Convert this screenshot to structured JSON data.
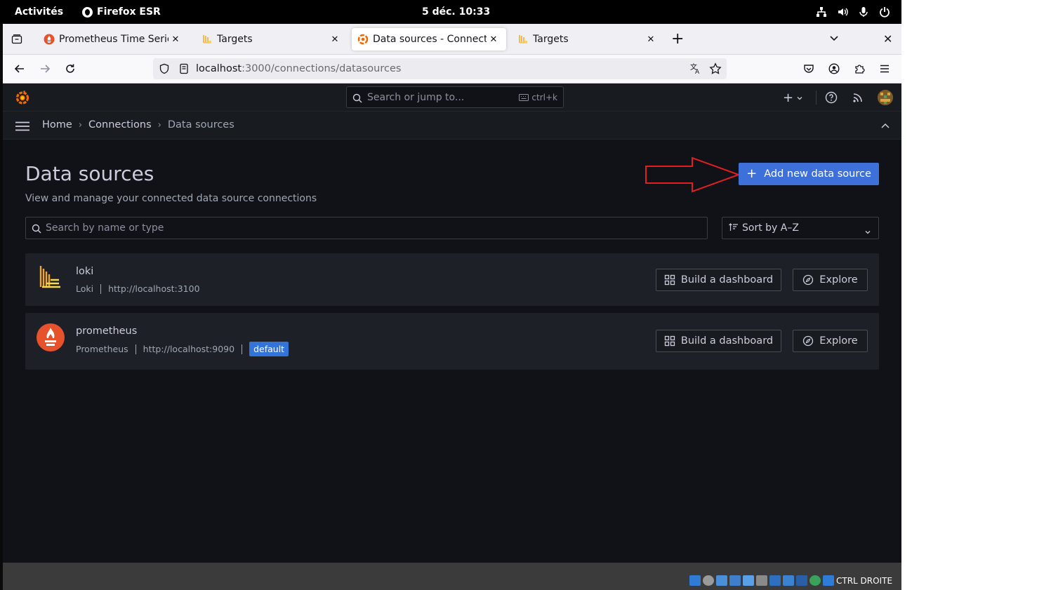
{
  "system_bar": {
    "activities": "Activités",
    "app_name": "Firefox ESR",
    "clock": "5 déc.  10:33"
  },
  "browser": {
    "tabs": [
      {
        "title": "Prometheus Time Series C",
        "favicon": "prometheus-icon",
        "active": false
      },
      {
        "title": "Targets",
        "favicon": "loki-icon",
        "active": false
      },
      {
        "title": "Data sources - Connection",
        "favicon": "grafana-icon",
        "active": true
      },
      {
        "title": "Targets",
        "favicon": "loki-icon",
        "active": false
      }
    ],
    "url_host": "localhost",
    "url_rest": ":3000/connections/datasources"
  },
  "grafana": {
    "search_placeholder": "Search or jump to...",
    "search_shortcut": "ctrl+k",
    "breadcrumbs": [
      "Home",
      "Connections",
      "Data sources"
    ],
    "page_title": "Data sources",
    "page_subtitle": "View and manage your connected data source connections",
    "add_button": "Add new data source",
    "filter_placeholder": "Search by name or type",
    "sort_label": "Sort by A–Z",
    "datasources": [
      {
        "name": "loki",
        "type": "Loki",
        "url": "http://localhost:3100",
        "default": false,
        "build_label": "Build a dashboard",
        "explore_label": "Explore"
      },
      {
        "name": "prometheus",
        "type": "Prometheus",
        "url": "http://localhost:9090",
        "default": true,
        "badge": "default",
        "build_label": "Build a dashboard",
        "explore_label": "Explore"
      }
    ],
    "colors": {
      "primary": "#3d71d9",
      "background": "#111217",
      "card": "#1d2026",
      "annotation_arrow": "#e02020"
    }
  },
  "vm_status": {
    "host_key": "CTRL DROITE"
  }
}
